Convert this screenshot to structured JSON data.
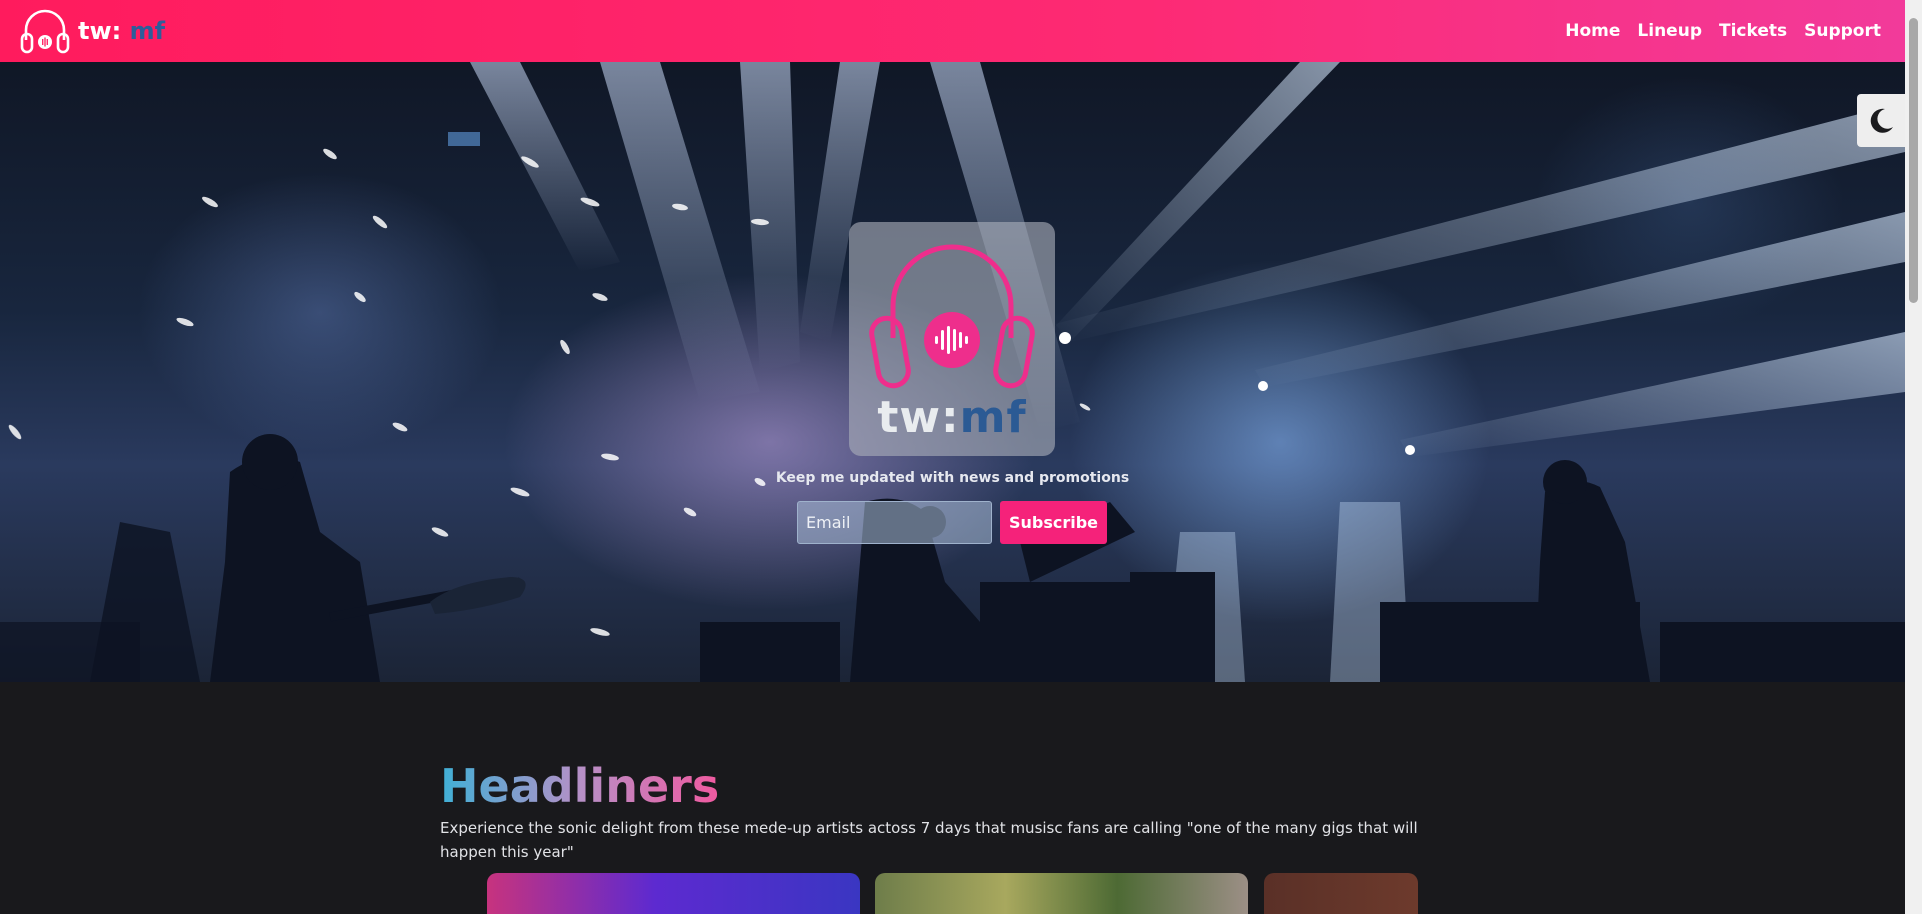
{
  "header": {
    "brand_tw": "tw:",
    "brand_mf": " mf",
    "nav": [
      "Home",
      "Lineup",
      "Tickets",
      "Support"
    ]
  },
  "hero": {
    "logo_tw": "tw:",
    "logo_mf": "mf",
    "tagline": "Keep me updated with news and promotions",
    "email_placeholder": "Email",
    "subscribe_label": "Subscribe"
  },
  "theme_toggle": {
    "icon": "moon-icon"
  },
  "headliners": {
    "title": "Headliners",
    "description": "Experience the sonic delight from these mede-up artists actoss 7 days that musisc fans are calling \"one of the many gigs that will happen this year\""
  },
  "colors": {
    "header_start": "#ff1b5d",
    "header_end": "#f23a9a",
    "accent_pink": "#f5227a",
    "brand_blue": "#2d5d9a",
    "page_bg": "#19191c"
  }
}
